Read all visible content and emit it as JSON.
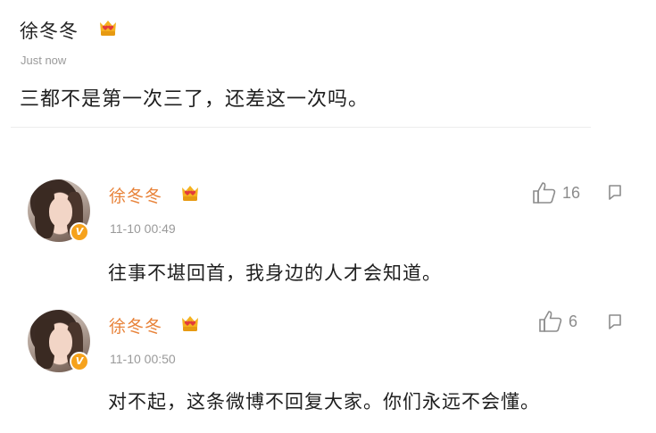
{
  "post": {
    "author": "徐冬冬",
    "badge_icon": "crown-heart-badge-icon",
    "time": "Just now",
    "text": "三都不是第一次三了，还差这一次吗。"
  },
  "comments": [
    {
      "author": "徐冬冬",
      "badge_icon": "crown-heart-badge-icon",
      "verified": "V",
      "time": "11-10 00:49",
      "text": "往事不堪回首，我身边的人才会知道。",
      "likes": "16"
    },
    {
      "author": "徐冬冬",
      "badge_icon": "crown-heart-badge-icon",
      "verified": "V",
      "time": "11-10 00:50",
      "text": "对不起，这条微博不回复大家。你们永远不会懂。",
      "likes": "6"
    }
  ],
  "colors": {
    "name_accent": "#e8833a",
    "verified": "#f6a21c",
    "meta": "#9a9a9a"
  }
}
